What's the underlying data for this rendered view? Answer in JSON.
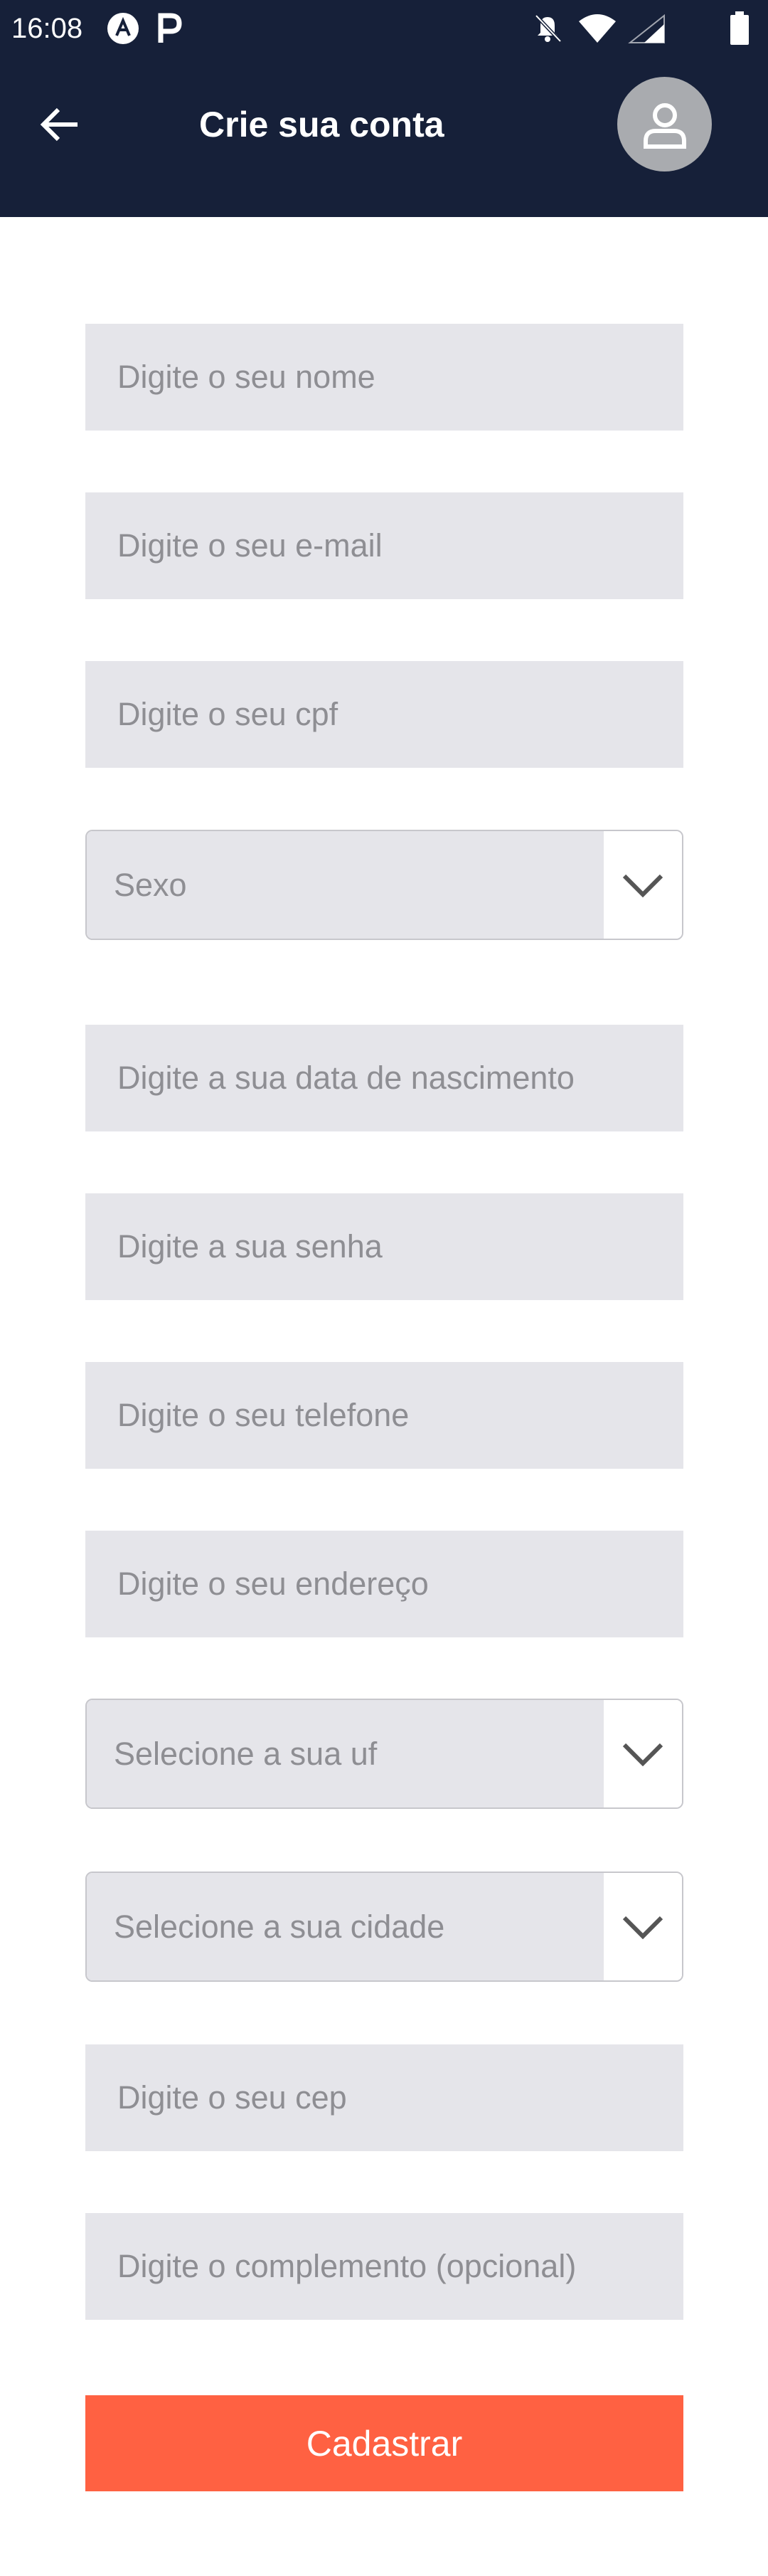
{
  "status_bar": {
    "time": "16:08",
    "icons": [
      "app-a-icon",
      "app-p-icon",
      "notifications-off-icon",
      "wifi-icon",
      "signal-icon",
      "battery-icon"
    ]
  },
  "app_bar": {
    "back_icon": "arrow-left-icon",
    "title": "Crie sua conta",
    "avatar_icon": "user-icon"
  },
  "form": {
    "nome": {
      "placeholder": "Digite o seu nome",
      "value": ""
    },
    "email": {
      "placeholder": "Digite o seu e-mail",
      "value": ""
    },
    "cpf": {
      "placeholder": "Digite o seu cpf",
      "value": ""
    },
    "sexo": {
      "selected": "Sexo"
    },
    "nascimento": {
      "placeholder": "Digite a sua data de nascimento",
      "value": ""
    },
    "senha": {
      "placeholder": "Digite a sua senha",
      "value": ""
    },
    "telefone": {
      "placeholder": "Digite o seu telefone",
      "value": ""
    },
    "endereco": {
      "placeholder": "Digite o seu endereço",
      "value": ""
    },
    "uf": {
      "selected": "Selecione a sua uf"
    },
    "cidade": {
      "selected": "Selecione a sua cidade"
    },
    "cep": {
      "placeholder": "Digite o seu cep",
      "value": ""
    },
    "complemento": {
      "placeholder": "Digite o complemento (opcional)",
      "value": ""
    },
    "submit_label": "Cadastrar"
  },
  "colors": {
    "header": "#162039",
    "field_bg": "#e5e5ea",
    "placeholder": "#8e8e93",
    "accent": "#ff6142"
  }
}
